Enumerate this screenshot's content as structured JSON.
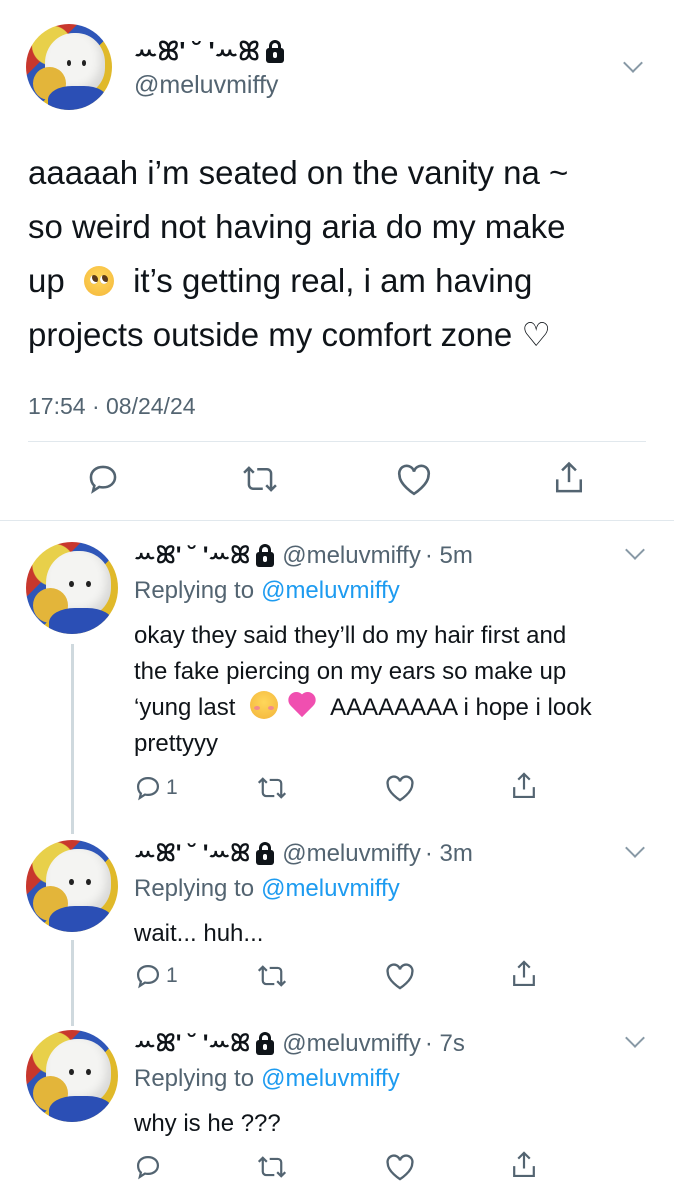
{
  "main_tweet": {
    "display_name": "ꕀꕤ' ˘ 'ꕀꕤ",
    "handle": "@meluvmiffy",
    "text_line1": "aaaaah i’m seated on the vanity na ~",
    "text_line2": "so weird not having aria do my make",
    "text_line3a": "up",
    "text_line3b": "it’s getting real, i am having",
    "text_line4": "projects outside my comfort zone ♡",
    "timestamp": "17:54 · 08/24/24"
  },
  "replies": [
    {
      "display_name": "ꕀꕤ' ˘ 'ꕀꕤ",
      "handle": "@meluvmiffy",
      "time": "· 5m",
      "replying_label": "Replying to",
      "replying_to": "@meluvmiffy",
      "text_line1": "okay they said they’ll do my hair first and",
      "text_line2": "the fake piercing on my ears so make up",
      "text_line3a": "‘yung last",
      "text_line3b": "AAAAAAAA i hope i look",
      "text_line4": "prettyyy",
      "reply_count": "1"
    },
    {
      "display_name": "ꕀꕤ' ˘ 'ꕀꕤ",
      "handle": "@meluvmiffy",
      "time": "· 3m",
      "replying_label": "Replying to",
      "replying_to": "@meluvmiffy",
      "text_line1": "wait... huh...",
      "reply_count": "1"
    },
    {
      "display_name": "ꕀꕤ' ˘ 'ꕀꕤ",
      "handle": "@meluvmiffy",
      "time": "· 7s",
      "replying_label": "Replying to",
      "replying_to": "@meluvmiffy",
      "text_line1": "why is he ???"
    }
  ],
  "icons": {
    "reply": "comment-icon",
    "retweet": "retweet-icon",
    "like": "heart-icon",
    "share": "share-icon",
    "more": "chevron-down-icon",
    "lock": "lock-icon"
  },
  "colors": {
    "link": "#1d9bf0",
    "secondary_text": "#536471",
    "divider": "#e1e8ed"
  }
}
